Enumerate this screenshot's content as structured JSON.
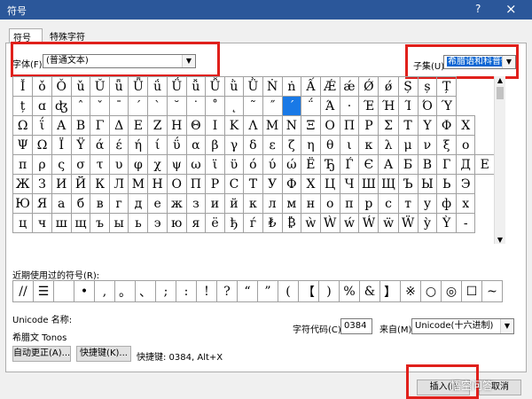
{
  "window": {
    "title": "符号",
    "help": "?",
    "close": "×"
  },
  "tabs": [
    {
      "label": "符号(S)"
    },
    {
      "label": "特殊字符(P)"
    }
  ],
  "font": {
    "label": "字体(F):",
    "value": "(普通文本)"
  },
  "subset": {
    "label": "子集(U):",
    "value": "希腊语和科普特"
  },
  "grid": {
    "rows": [
      [
        "Ǐ",
        "ǒ",
        "Ǒ",
        "ǔ",
        "Ǔ",
        "ǖ",
        "Ǖ",
        "ǘ",
        "Ǘ",
        "ǚ",
        "Ǚ",
        "ǜ",
        "Ǜ",
        "Ṅ",
        "ṅ",
        "Ấ",
        "Ǽ",
        "ǽ",
        "Ǿ",
        "ǿ",
        "Ș",
        "ș",
        "Ț"
      ],
      [
        "ț",
        "ɑ",
        "ʤ",
        "ˆ",
        "ˇ",
        "ˉ",
        "ˊ",
        "ˋ",
        "˘",
        "˙",
        "˚",
        "˛",
        "˜",
        "˝",
        "΄",
        "΅",
        "Ά",
        "·",
        "Έ",
        "Ή",
        "Ί",
        "Ό",
        "Ύ"
      ],
      [
        "Ω",
        "ΐ",
        "Α",
        "Β",
        "Γ",
        "Δ",
        "Ε",
        "Ζ",
        "Η",
        "Θ",
        "Ι",
        "Κ",
        "Λ",
        "Μ",
        "Ν",
        "Ξ",
        "Ο",
        "Π",
        "Ρ",
        "Σ",
        "Τ",
        "Υ",
        "Φ",
        "Χ"
      ],
      [
        "Ψ",
        "Ω",
        "Ϊ",
        "Ϋ",
        "ά",
        "έ",
        "ή",
        "ί",
        "ΰ",
        "α",
        "β",
        "γ",
        "δ",
        "ε",
        "ζ",
        "η",
        "θ",
        "ι",
        "κ",
        "λ",
        "μ",
        "ν",
        "ξ",
        "ο"
      ],
      [
        "π",
        "ρ",
        "ς",
        "σ",
        "τ",
        "υ",
        "φ",
        "χ",
        "ψ",
        "ω",
        "ϊ",
        "ϋ",
        "ό",
        "ύ",
        "ώ",
        "Ё",
        "Ђ",
        "Ѓ",
        "Є",
        "А",
        "Б",
        "В",
        "Г",
        "Д",
        "Е"
      ],
      [
        "Ж",
        "З",
        "И",
        "Й",
        "К",
        "Л",
        "М",
        "Н",
        "О",
        "П",
        "Р",
        "С",
        "Т",
        "У",
        "Ф",
        "Х",
        "Ц",
        "Ч",
        "Ш",
        "Щ",
        "Ъ",
        "Ы",
        "Ь",
        "Э"
      ],
      [
        "Ю",
        "Я",
        "а",
        "б",
        "в",
        "г",
        "д",
        "е",
        "ж",
        "з",
        "и",
        "й",
        "к",
        "л",
        "м",
        "н",
        "о",
        "п",
        "р",
        "с",
        "т",
        "у",
        "ф",
        "х"
      ],
      [
        "ц",
        "ч",
        "ш",
        "щ",
        "ъ",
        "ы",
        "ь",
        "э",
        "ю",
        "я",
        "ё",
        "ђ",
        "ѓ",
        "₺",
        "₿",
        "ẁ",
        "Ẁ",
        "ẃ",
        "Ẃ",
        "ẅ",
        "Ẅ",
        "ỳ",
        "Ỳ",
        "-"
      ]
    ]
  },
  "recent": {
    "label": "近期使用过的符号(R):",
    "symbols": [
      "//",
      "☰",
      "",
      "•",
      ",",
      "。",
      "、",
      ";",
      ":",
      "!",
      "?",
      "“",
      "”",
      "(",
      "【",
      ")",
      "%",
      "&",
      "】",
      "※",
      "○",
      "◎",
      "☐",
      "~"
    ]
  },
  "unicode": {
    "label": "Unicode 名称:",
    "name": "希腊文 Tonos"
  },
  "code": {
    "label": "字符代码(C):",
    "value": "0384",
    "from_label": "来自(M):",
    "from_value": "Unicode(十六进制)"
  },
  "buttons": {
    "autocorrect": "自动更正(A)...",
    "shortcut": "快捷键(K)...",
    "shortcut_info": "快捷键: 0384, Alt+X",
    "insert": "插入(I)",
    "cancel": "取消"
  },
  "watermark": "悟空问答",
  "colors": {
    "accent": "#2b579a",
    "highlight": "#e0201b",
    "selection": "#1979e6"
  }
}
